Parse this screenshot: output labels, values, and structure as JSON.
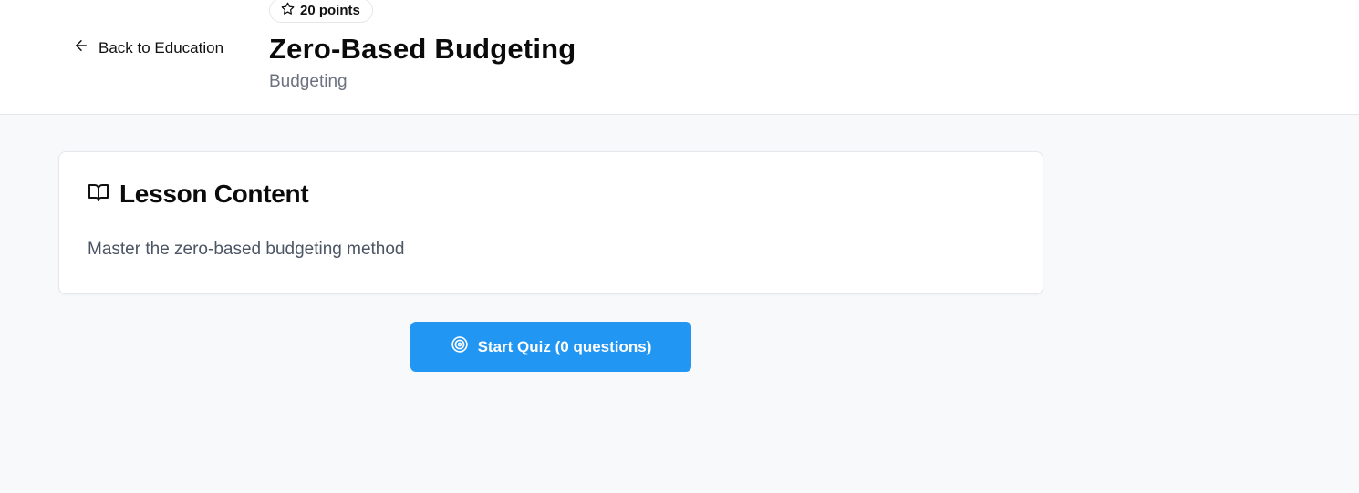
{
  "header": {
    "back_label": "Back to Education",
    "points_label": "20 points",
    "title": "Zero-Based Budgeting",
    "category": "Budgeting"
  },
  "lesson": {
    "heading": "Lesson Content",
    "body": "Master the zero-based budgeting method"
  },
  "quiz": {
    "button_label": "Start Quiz (0 questions)"
  },
  "icons": {
    "back": "arrow-left-icon",
    "points": "star-icon",
    "lesson": "book-open-icon",
    "quiz": "target-icon"
  },
  "colors": {
    "accent": "#2196f3",
    "background": "#f8f9fb",
    "muted_text": "#6b7280"
  }
}
